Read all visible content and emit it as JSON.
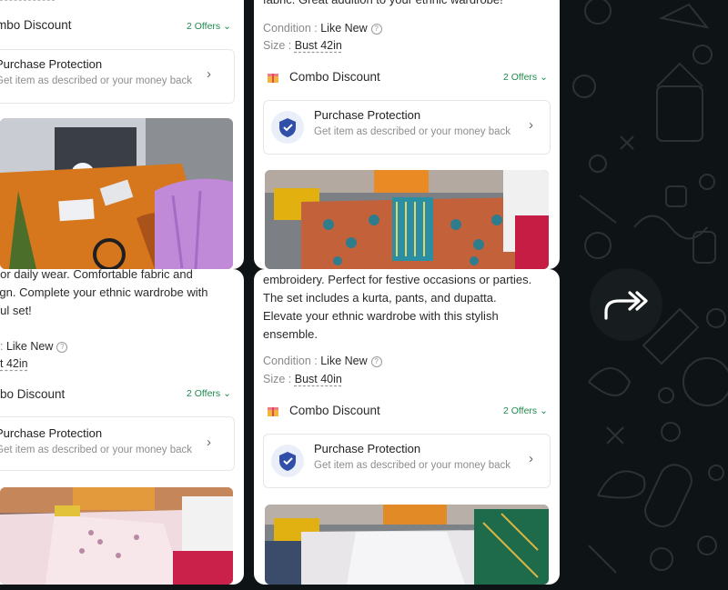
{
  "cards": [
    {
      "id": "top-left",
      "combo_label": "mbo Discount",
      "offers_label": "2 Offers",
      "protection_title": "Purchase Protection",
      "protection_sub": "Get item as described or your money back"
    },
    {
      "id": "top-right",
      "desc_line": "fabric. Great addition to your ethnic wardrobe!",
      "condition_label": "Condition : ",
      "condition_value": "Like New",
      "size_label": "Size : ",
      "size_value": "Bust 42in",
      "combo_label": "Combo Discount",
      "offers_label": "2 Offers",
      "protection_title": "Purchase Protection",
      "protection_sub": "Get item as described or your money back"
    },
    {
      "id": "bottom-left",
      "desc_lines": [
        "s or daily wear.  Comfortable fabric and",
        "sign.  Complete your ethnic wardrobe with",
        "tiful set!"
      ],
      "condition_value": "Like New",
      "size_value": "t 42in",
      "combo_label": "bo Discount",
      "offers_label": "2 Offers",
      "protection_title": "Purchase Protection",
      "protection_sub": "Get item as described or your money back"
    },
    {
      "id": "bottom-right",
      "desc_lines": [
        "embroidery. Perfect for festive occasions or parties.",
        "The set includes a kurta, pants, and dupatta.",
        "Elevate your ethnic wardrobe with this stylish",
        "ensemble."
      ],
      "condition_label": "Condition : ",
      "condition_value": "Like New",
      "size_label": "Size : ",
      "size_value": "Bust 40in",
      "combo_label": "Combo Discount",
      "offers_label": "2 Offers",
      "protection_title": "Purchase Protection",
      "protection_sub": "Get item as described or your money back"
    }
  ],
  "bl_condition_prefix": ": ",
  "icons": {
    "forward": "forward-arrow-icon",
    "chevron": "chevron-right-icon",
    "shield": "shield-check-icon",
    "gift": "gift-icon",
    "help": "help-circle-icon"
  },
  "colors": {
    "background": "#0e1416",
    "offers_green": "#1f8a4c",
    "shield_blue": "#2f4fa8"
  }
}
